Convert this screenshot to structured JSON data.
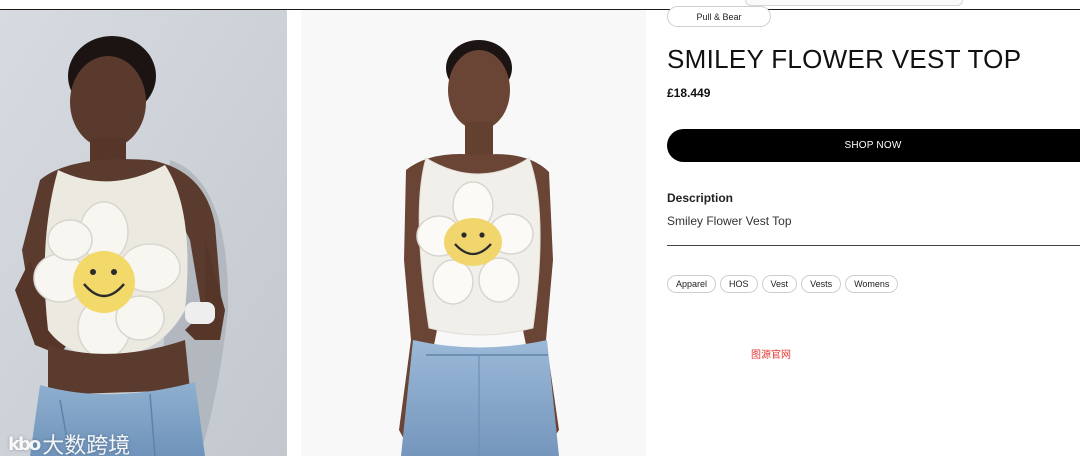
{
  "product": {
    "brand": "Pull & Bear",
    "title": "SMILEY FLOWER VEST TOP",
    "price": "£18.449",
    "cta_label": "SHOP NOW",
    "description_heading": "Description",
    "description_text": "Smiley Flower Vest Top",
    "tags": [
      "Apparel",
      "HOS",
      "Vest",
      "Vests",
      "Womens"
    ]
  },
  "overlay": {
    "watermark_text": "大数跨境",
    "watermark_logo": "kbo",
    "red_mark": "图源官网"
  },
  "colors": {
    "accent": "#000000",
    "cta_text": "#ffffff",
    "red_mark": "#e53935"
  },
  "images": [
    {
      "name": "product-photo-front-pose",
      "depicts": "model wearing smiley flower vest top, hands at hem"
    },
    {
      "name": "product-photo-studio",
      "depicts": "model wearing smiley flower vest top with jeans on white background"
    }
  ]
}
